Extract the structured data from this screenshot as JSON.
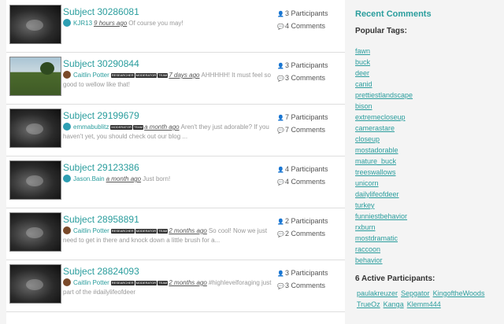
{
  "subjects": [
    {
      "title": "Subject 30286081",
      "user": "KJR13",
      "badges": [],
      "when": "9 hours ago",
      "comment": "Of course you may!",
      "participants": "3 Participants",
      "comments": "4 Comments",
      "avatar_color": "#2e9fb3",
      "thumb": "night"
    },
    {
      "title": "Subject 30290844",
      "user": "Caitlin Potter",
      "badges": [
        "RESEARCHER",
        "MODERATOR",
        "TEAM"
      ],
      "when": "7 days ago",
      "comment": "AHHHHH! It must feel so good to wellow like that!",
      "participants": "3 Participants",
      "comments": "3 Comments",
      "avatar_color": "#7a4a2a",
      "thumb": "day"
    },
    {
      "title": "Subject 29199679",
      "user": "emmabublitz",
      "badges": [
        "MODERATOR",
        "TEAM"
      ],
      "when": "a month ago",
      "comment": "Aren't they just adorable? If you haven't yet, you should check out our blog ...",
      "participants": "7 Participants",
      "comments": "7 Comments",
      "avatar_color": "#2e9fb3",
      "thumb": "night"
    },
    {
      "title": "Subject 29123386",
      "user": "Jason.Bain",
      "badges": [],
      "when": "a month ago",
      "comment": "Just born!",
      "participants": "4 Participants",
      "comments": "4 Comments",
      "avatar_color": "#2e9fb3",
      "thumb": "night"
    },
    {
      "title": "Subject 28958891",
      "user": "Caitlin Potter",
      "badges": [
        "RESEARCHER",
        "MODERATOR",
        "TEAM"
      ],
      "when": "2 months ago",
      "comment": "So cool! Now we just need to get in there and knock down a little brush for a...",
      "participants": "2 Participants",
      "comments": "2 Comments",
      "avatar_color": "#7a4a2a",
      "thumb": "night"
    },
    {
      "title": "Subject 28824093",
      "user": "Caitlin Potter",
      "badges": [
        "RESEARCHER",
        "MODERATOR",
        "TEAM"
      ],
      "when": "2 months ago",
      "comment": "#highlevelforaging just part of the #dailylifeofdeer",
      "participants": "3 Participants",
      "comments": "3 Comments",
      "avatar_color": "#7a4a2a",
      "thumb": "night"
    }
  ],
  "sidebar": {
    "recent_comments": "Recent Comments",
    "popular_tags": "Popular Tags:",
    "tags": [
      "fawn",
      "buck",
      "deer",
      "canid",
      "prettiestlandscape",
      "bison",
      "extremecloseup",
      "camerastare",
      "closeup",
      "mostadorable",
      "mature_buck",
      "treeswallows",
      "unicorn",
      "dailylifeofdeer",
      "turkey",
      "funniestbehavior",
      "rxburn",
      "mostdramatic",
      "raccoon",
      "behavior"
    ],
    "active_title": "6 Active Participants:",
    "participants": [
      "paulakreuzer",
      "Sepgator",
      "KingoftheWoods",
      "TrueOz",
      "Kanga",
      "Klemm444"
    ]
  },
  "icons": {
    "participants": "users-icon",
    "comments": "comment-bubble-icon"
  }
}
